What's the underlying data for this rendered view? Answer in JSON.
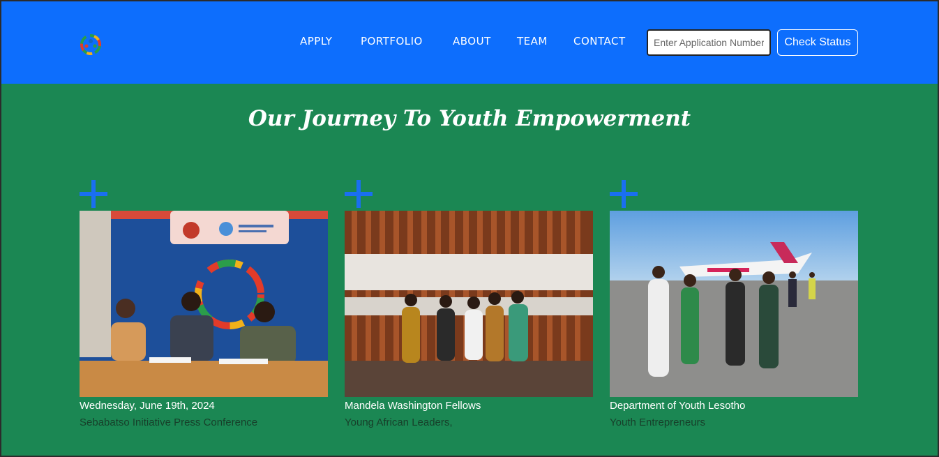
{
  "header": {
    "logo": "colorful-people-circle-logo",
    "nav": [
      {
        "label": "APPLY"
      },
      {
        "label": "PORTFOLIO"
      },
      {
        "label": "ABOUT"
      },
      {
        "label": "TEAM"
      },
      {
        "label": "CONTACT"
      }
    ],
    "search": {
      "placeholder": "Enter Application Number",
      "value": ""
    },
    "check_status_label": "Check Status"
  },
  "main": {
    "title": "Our Journey To Youth Empowerment",
    "cards": [
      {
        "heading": "Wednesday, June 19th, 2024",
        "subtitle": "Sebabatso Initiative Press Conference",
        "icon": "plus-icon"
      },
      {
        "heading": "Mandela Washington Fellows",
        "subtitle": "Young African Leaders,",
        "icon": "plus-icon"
      },
      {
        "heading": "Department of Youth Lesotho",
        "subtitle": "Youth Entrepreneurs",
        "icon": "plus-icon"
      }
    ]
  },
  "colors": {
    "header_bg": "#0d6efd",
    "body_bg": "#1b8753",
    "plus": "#1a6ff0"
  }
}
